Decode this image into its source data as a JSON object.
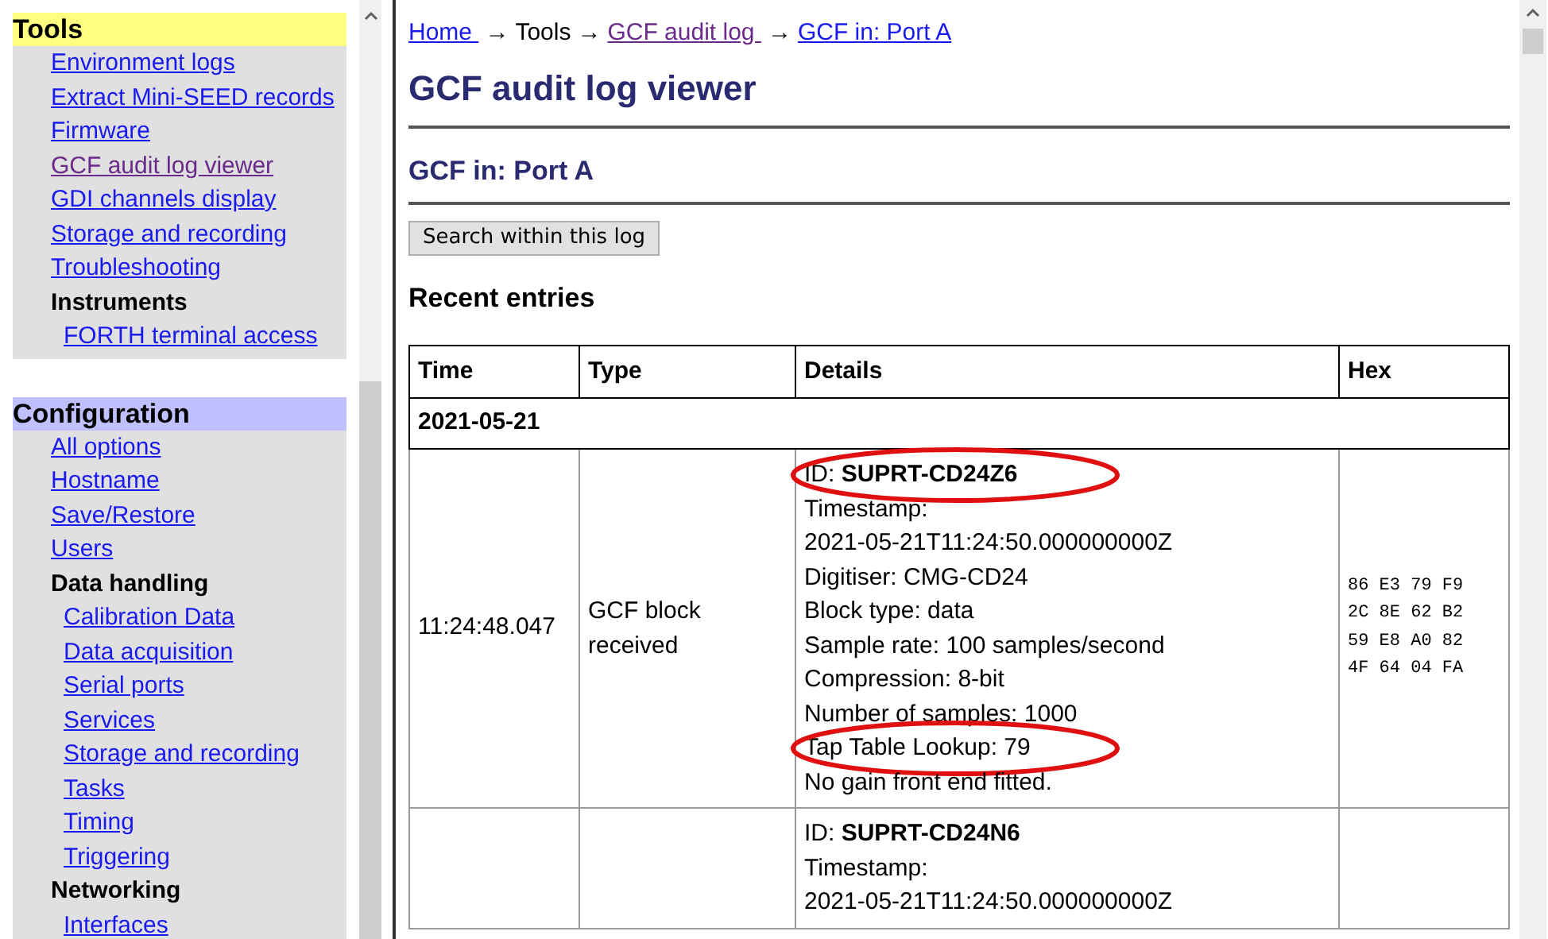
{
  "sidebar": {
    "sections": [
      {
        "title": "Tools",
        "color": "#ffff80",
        "items": [
          {
            "kind": "link",
            "label": "Environment logs",
            "visited": false
          },
          {
            "kind": "link",
            "label": "Extract Mini-SEED records",
            "visited": false
          },
          {
            "kind": "link",
            "label": "Firmware",
            "visited": false
          },
          {
            "kind": "link",
            "label": "GCF audit log viewer",
            "visited": true
          },
          {
            "kind": "link",
            "label": "GDI channels display",
            "visited": false
          },
          {
            "kind": "link",
            "label": "Storage and recording",
            "visited": false
          },
          {
            "kind": "link",
            "label": "Troubleshooting",
            "visited": false
          },
          {
            "kind": "heading",
            "label": "Instruments"
          },
          {
            "kind": "sublink",
            "label": "FORTH terminal access",
            "visited": false
          }
        ]
      },
      {
        "title": "Configuration",
        "color": "#c0c0ff",
        "items": [
          {
            "kind": "link",
            "label": "All options",
            "visited": false
          },
          {
            "kind": "link",
            "label": "Hostname",
            "visited": false
          },
          {
            "kind": "link",
            "label": "Save/Restore",
            "visited": false
          },
          {
            "kind": "link",
            "label": "Users",
            "visited": false
          },
          {
            "kind": "heading",
            "label": "Data handling"
          },
          {
            "kind": "sublink",
            "label": "Calibration Data",
            "visited": false
          },
          {
            "kind": "sublink",
            "label": "Data acquisition",
            "visited": false
          },
          {
            "kind": "sublink",
            "label": "Serial ports",
            "visited": false
          },
          {
            "kind": "sublink",
            "label": "Services",
            "visited": false
          },
          {
            "kind": "sublink",
            "label": "Storage and recording",
            "visited": false
          },
          {
            "kind": "sublink",
            "label": "Tasks",
            "visited": false
          },
          {
            "kind": "sublink",
            "label": "Timing",
            "visited": false
          },
          {
            "kind": "sublink",
            "label": "Triggering",
            "visited": false
          },
          {
            "kind": "heading",
            "label": "Networking"
          },
          {
            "kind": "sublink",
            "label": "Interfaces",
            "visited": false
          }
        ]
      }
    ]
  },
  "breadcrumb": {
    "separator": "→",
    "items": [
      {
        "kind": "link",
        "label": "Home ",
        "visited": false
      },
      {
        "kind": "text",
        "label": "Tools"
      },
      {
        "kind": "link",
        "label": "GCF audit log ",
        "visited": true
      },
      {
        "kind": "link",
        "label": "GCF in: Port A",
        "visited": false
      }
    ]
  },
  "title": "GCF audit log viewer",
  "subtitle": "GCF in: Port A",
  "search_button": "Search within this log",
  "section_heading": "Recent entries",
  "table": {
    "columns": [
      "Time",
      "Type",
      "Details",
      "Hex"
    ],
    "date_row": "2021-05-21",
    "rows": [
      {
        "time": "11:24:48.047",
        "type": "GCF block received",
        "details": [
          {
            "text": "ID: **SUPRT-CD24Z6**",
            "circled": true
          },
          {
            "text": "Timestamp:",
            "circled": false
          },
          {
            "text": "2021-05-21T11:24:50.000000000Z",
            "circled": false
          },
          {
            "text": "Digitiser: CMG-CD24",
            "circled": false
          },
          {
            "text": "Block type: data",
            "circled": false
          },
          {
            "text": "Sample rate: 100 samples/second",
            "circled": false
          },
          {
            "text": "Compression: 8-bit",
            "circled": false
          },
          {
            "text": "Number of samples: 1000",
            "circled": false
          },
          {
            "text": "Tap Table Lookup: 79",
            "circled": true
          },
          {
            "text": "No gain front end fitted.",
            "circled": false
          }
        ],
        "hex": [
          "86 E3 79 F9",
          "2C 8E 62 B2",
          "59 E8 A0 82",
          "4F 64 04 FA"
        ]
      },
      {
        "time": "",
        "type": "",
        "details": [
          {
            "text": "ID: **SUPRT-CD24N6**",
            "circled": false
          },
          {
            "text": "Timestamp:",
            "circled": false
          },
          {
            "text": "2021-05-21T11:24:50.000000000Z",
            "circled": false
          }
        ],
        "hex": []
      }
    ]
  }
}
